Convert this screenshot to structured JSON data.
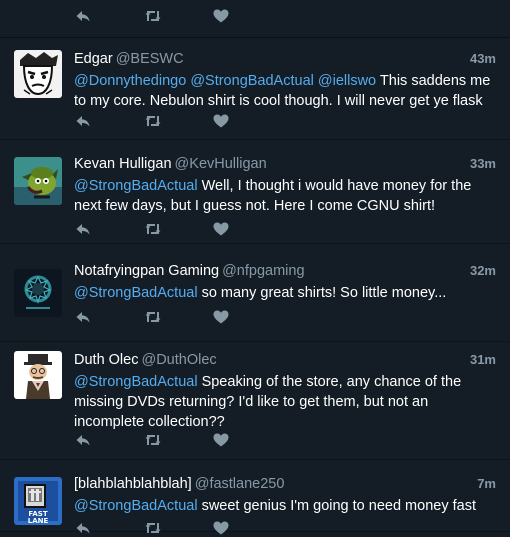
{
  "tweets": [
    {
      "name": "Edgar",
      "handle": "@BESWC",
      "time": "43m",
      "segments": [
        {
          "t": "@Donnythedingo",
          "m": true
        },
        {
          "t": " ",
          "m": false
        },
        {
          "t": "@StrongBadActual",
          "m": true
        },
        {
          "t": " ",
          "m": false
        },
        {
          "t": "@iellswo",
          "m": true
        },
        {
          "t": " This saddens me to my core. Nebulon shirt is cool though. I will never get ye flask",
          "m": false
        }
      ],
      "avatar": "edgar-avatar"
    },
    {
      "name": "Kevan Hulligan",
      "handle": "@KevHulligan",
      "time": "33m",
      "segments": [
        {
          "t": "@StrongBadActual",
          "m": true
        },
        {
          "t": " Well, I thought i would have money for the next few days, but I guess not. Here I come CGNU shirt!",
          "m": false
        }
      ],
      "avatar": "kevan-avatar"
    },
    {
      "name": "Notafryingpan Gaming",
      "handle": "@nfpgaming",
      "time": "32m",
      "segments": [
        {
          "t": "@StrongBadActual",
          "m": true
        },
        {
          "t": " so many great shirts! So little money...",
          "m": false
        }
      ],
      "avatar": "nfp-avatar"
    },
    {
      "name": "Duth Olec",
      "handle": "@DuthOlec",
      "time": "31m",
      "segments": [
        {
          "t": "@StrongBadActual",
          "m": true
        },
        {
          "t": " Speaking of the store, any chance of the missing DVDs returning? I'd like to get them, but not an incomplete collection??",
          "m": false
        }
      ],
      "avatar": "duth-avatar"
    },
    {
      "name": "[blahblahblahblah]",
      "handle": "@fastlane250",
      "time": "7m",
      "segments": [
        {
          "t": "@StrongBadActual",
          "m": true
        },
        {
          "t": " sweet genius I'm going to need money fast",
          "m": false
        }
      ],
      "avatar": "fastlane-avatar",
      "avatar_text": "FAST LANE"
    }
  ],
  "icons": {
    "reply": "reply-icon",
    "retweet": "retweet-icon",
    "like": "heart-icon"
  },
  "colors": {
    "background": "#141d26",
    "mention": "#55acee",
    "muted": "#8899a6",
    "action": "#8899a6"
  }
}
